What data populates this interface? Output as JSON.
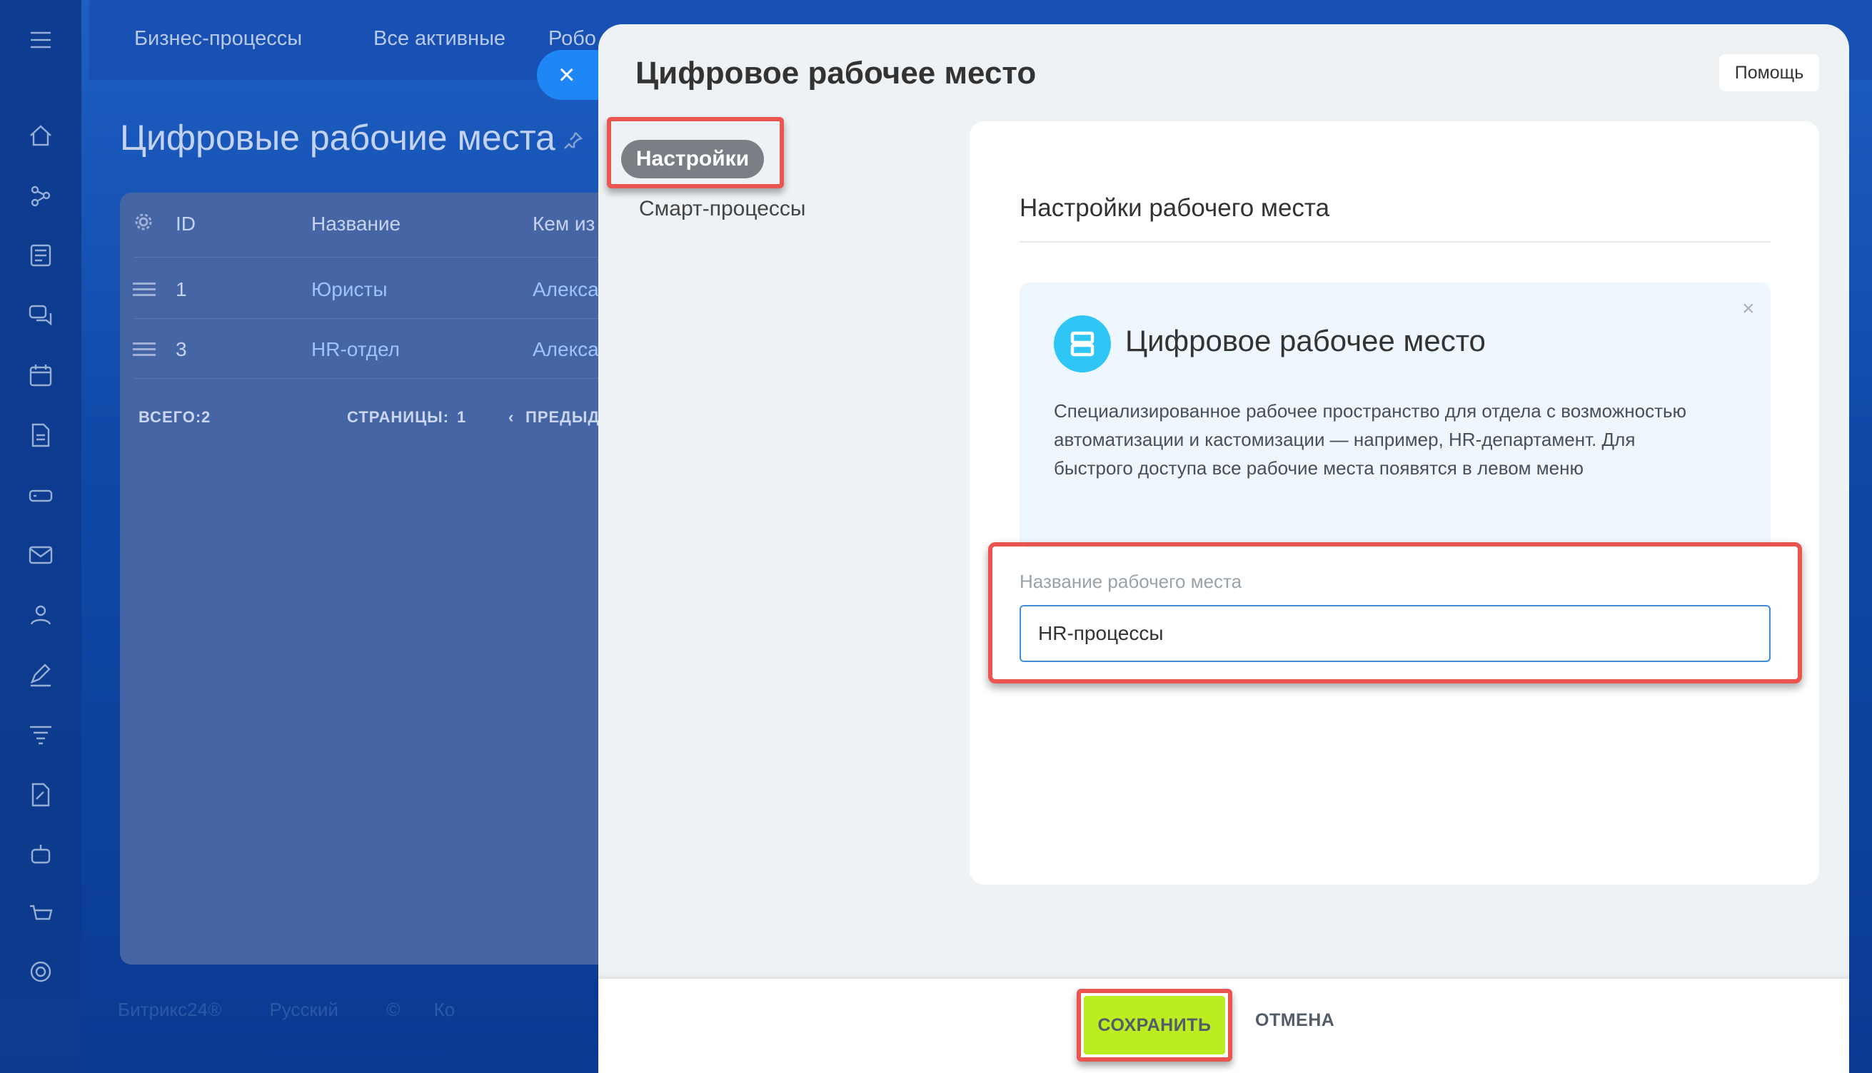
{
  "background": {
    "topbar": [
      "Бизнес-процессы",
      "Все активные",
      "Робо"
    ],
    "page_title": "Цифровые рабочие места",
    "grid": {
      "columns": [
        "ID",
        "Название",
        "Кем из"
      ],
      "rows": [
        {
          "id": "1",
          "name": "Юристы",
          "author": "Алекса"
        },
        {
          "id": "3",
          "name": "HR-отдел",
          "author": "Алекса"
        }
      ],
      "total_label": "ВСЕГО:",
      "total_value": "2",
      "pages_label": "СТРАНИЦЫ:",
      "pages_value": "1",
      "prev_label": "ПРЕДЫД"
    },
    "bottom_bar": [
      "Битрикс24®",
      "Русский",
      "©",
      "Ко"
    ]
  },
  "panel": {
    "title": "Цифровое рабочее место",
    "help_label": "Помощь",
    "nav": {
      "settings": "Настройки",
      "smart_processes": "Смарт-процессы"
    },
    "section_title": "Настройки рабочего места",
    "info": {
      "title": "Цифровое рабочее место",
      "text": "Специализированное рабочее пространство для отдела с возможностью автоматизации и кастомизации — например, HR-департамент. Для быстрого доступа все рабочие места появятся в левом меню",
      "close_glyph": "×"
    },
    "field": {
      "label": "Название рабочего места",
      "value": "HR-процессы"
    },
    "footer": {
      "save_label": "СОХРАНИТЬ",
      "cancel_label": "ОТМЕНА"
    },
    "close_glyph": "×"
  },
  "colors": {
    "save_button": "#bbed21",
    "highlight": "#ea5550",
    "info_icon": "#2fc6f6",
    "input_border": "#3d8fd8"
  }
}
